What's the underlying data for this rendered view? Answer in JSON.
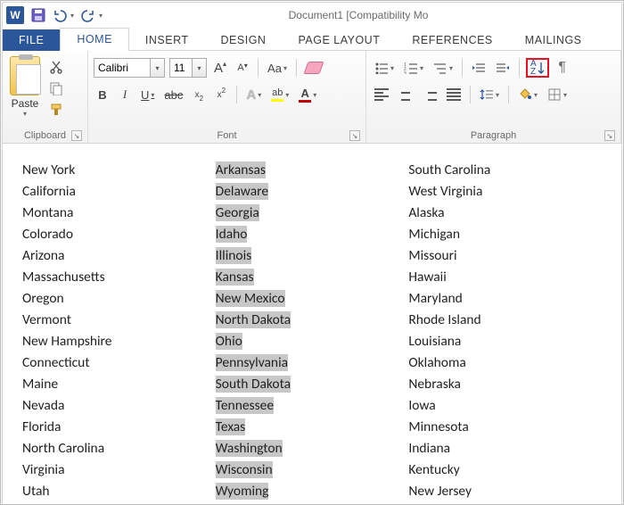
{
  "titlebar": {
    "title": "Document1 [Compatibility Mo"
  },
  "tabs": {
    "file": "FILE",
    "home": "HOME",
    "insert": "INSERT",
    "design": "DESIGN",
    "page_layout": "PAGE LAYOUT",
    "references": "REFERENCES",
    "mailings": "MAILINGS"
  },
  "ribbon": {
    "clipboard": {
      "label": "Clipboard",
      "paste": "Paste"
    },
    "font": {
      "label": "Font",
      "font_name": "Calibri",
      "font_size": "11",
      "bold": "B",
      "italic": "I",
      "underline": "U",
      "strike": "abc",
      "case": "Aa"
    },
    "paragraph": {
      "label": "Paragraph",
      "sort_a": "A",
      "sort_z": "Z",
      "pilcrow": "¶"
    }
  },
  "document": {
    "col1": [
      "New York",
      "California",
      "Montana",
      "Colorado",
      "Arizona",
      "Massachusetts",
      "Oregon",
      "Vermont",
      "New Hampshire",
      "Connecticut",
      "Maine",
      "Nevada",
      "Florida",
      "North Carolina",
      "Virginia",
      "Utah"
    ],
    "col2": [
      "Arkansas",
      "Delaware",
      "Georgia",
      "Idaho",
      "Illinois",
      "Kansas",
      "New Mexico",
      "North Dakota",
      "Ohio",
      "Pennsylvania",
      "South Dakota",
      "Tennessee",
      "Texas",
      "Washington",
      "Wisconsin",
      "Wyoming"
    ],
    "col3": [
      "South Carolina",
      "West Virginia",
      "Alaska",
      "Michigan",
      "Missouri",
      "Hawaii",
      "Maryland",
      "Rhode Island",
      "Louisiana",
      "Oklahoma",
      "Nebraska",
      "Iowa",
      "Minnesota",
      "Indiana",
      "Kentucky",
      "New Jersey"
    ]
  }
}
